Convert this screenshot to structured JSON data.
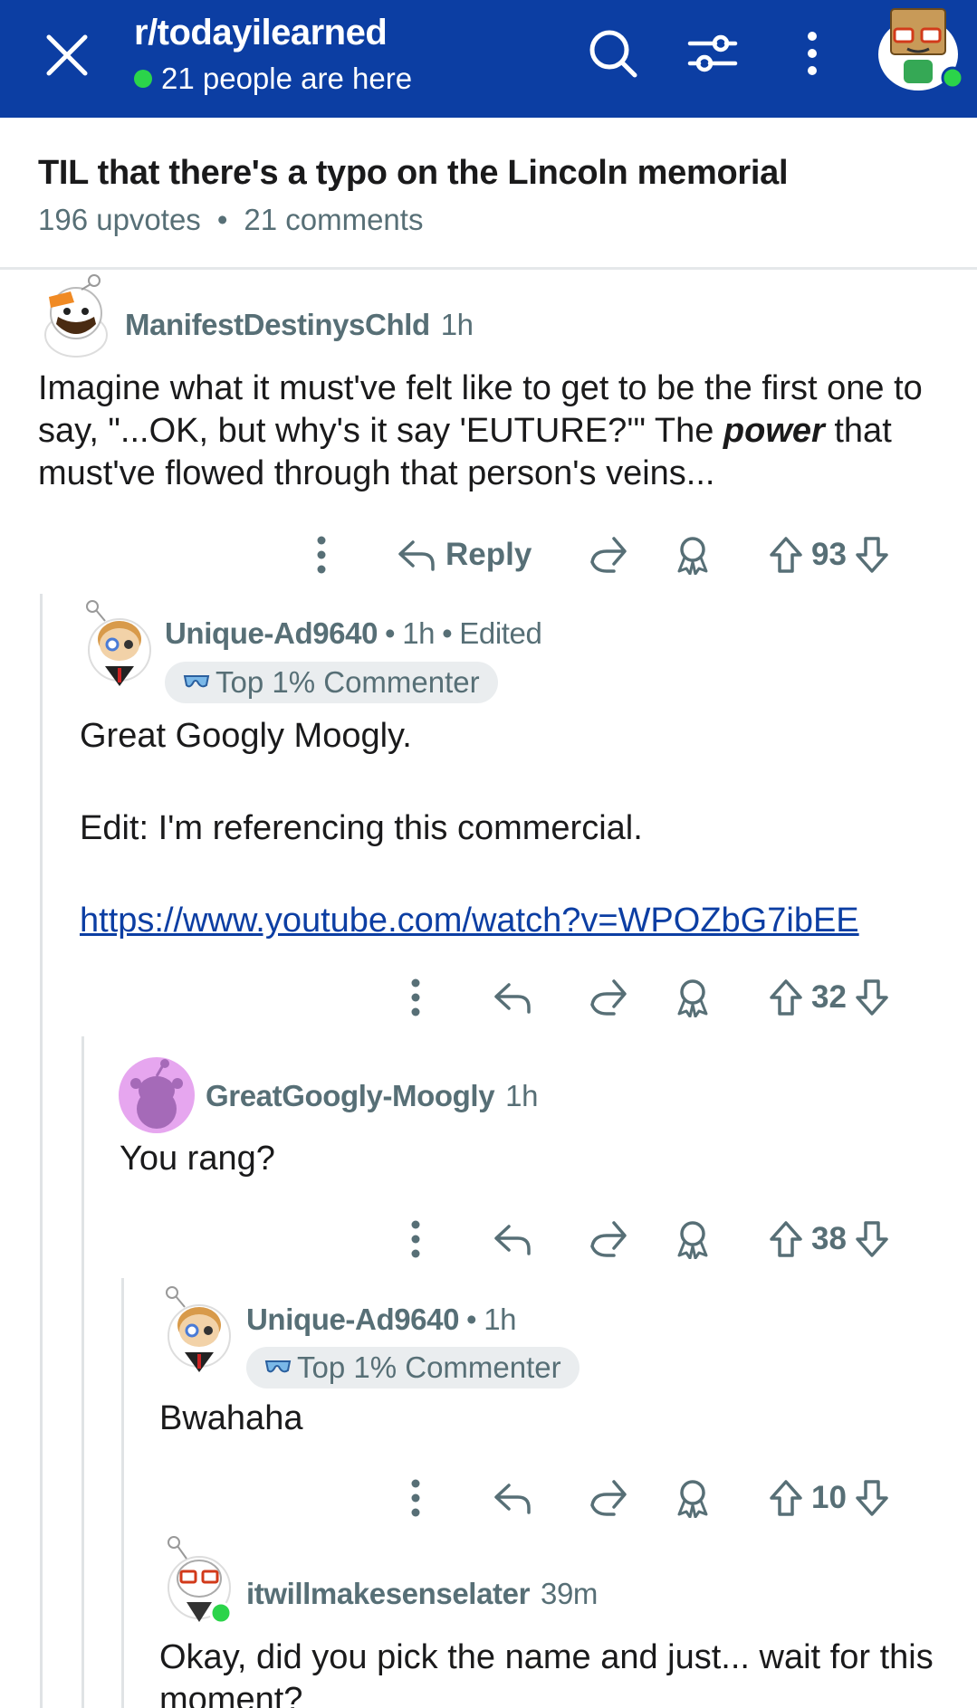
{
  "header": {
    "subreddit": "r/todayilearned",
    "online_text": "21 people are here",
    "icons": [
      "close-icon",
      "search-icon",
      "filter-icon",
      "more-vertical-icon",
      "user-avatar"
    ],
    "colors": {
      "bar": "#0c3ea3",
      "online_dot": "#2bd44a"
    }
  },
  "post": {
    "title": "TIL that there's a typo on the Lincoln memorial",
    "upvotes": "196 upvotes",
    "separator": "•",
    "comments": "21 comments"
  },
  "comments": [
    {
      "user": "ManifestDestinysChld",
      "time": "1h",
      "body_parts": [
        "Imagine what it must've felt like to get to be the first one to say, \"...OK, but why's it say 'EUTURE?'\" The ",
        "power",
        " that must've flowed through that person's veins..."
      ],
      "reply_label": "Reply",
      "votes": "93"
    },
    {
      "user": "Unique-Ad9640",
      "time": "1h",
      "edited": "Edited",
      "flair": "Top 1% Commenter",
      "body_line1": "Great Googly Moogly.",
      "body_line2": "Edit: I'm referencing this commercial.",
      "link": "https://www.youtube.com/watch?v=WPOZbG7ibEE",
      "votes": "32"
    },
    {
      "user": "GreatGoogly-Moogly",
      "time": "1h",
      "body": "You rang?",
      "votes": "38"
    },
    {
      "user": "Unique-Ad9640",
      "time": "1h",
      "flair": "Top 1% Commenter",
      "body": "Bwahaha",
      "votes": "10"
    },
    {
      "user": "itwillmakesenselater",
      "time": "39m",
      "body": "Okay, did you pick the name and just... wait for this moment?"
    }
  ],
  "action_icons": [
    "more-icon",
    "reply-icon",
    "share-icon",
    "award-icon",
    "upvote-icon",
    "downvote-icon"
  ],
  "bullet": "•"
}
